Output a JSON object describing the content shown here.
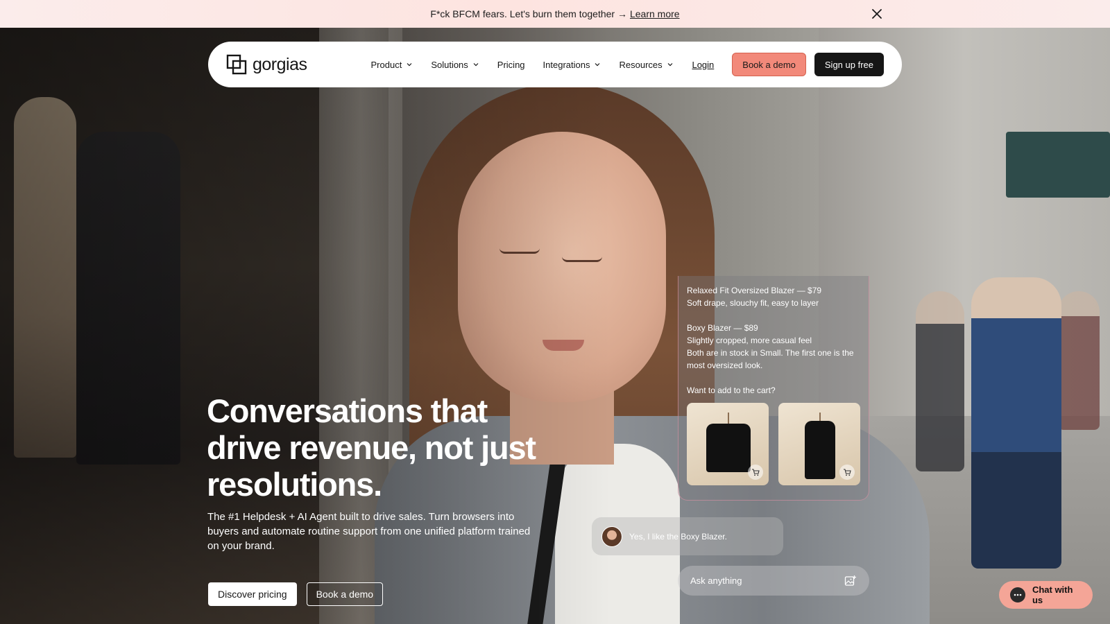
{
  "announcement": {
    "text": "F*ck BFCM fears. Let's burn them together →",
    "link_label": "Learn more"
  },
  "nav": {
    "logo": "gorgias",
    "items": [
      {
        "label": "Product",
        "has_dropdown": true
      },
      {
        "label": "Solutions",
        "has_dropdown": true
      },
      {
        "label": "Pricing",
        "has_dropdown": false
      },
      {
        "label": "Integrations",
        "has_dropdown": true
      },
      {
        "label": "Resources",
        "has_dropdown": true
      }
    ],
    "login": "Login",
    "book_demo": "Book a demo",
    "sign_up": "Sign up free"
  },
  "hero": {
    "title": "Conversations that drive revenue, not just resolutions.",
    "subtitle": "The #1 Helpdesk + AI Agent built to drive sales. Turn browsers into buyers and automate routine support from one unified platform trained on your brand.",
    "primary_button": "Discover pricing",
    "secondary_button": "Book a demo"
  },
  "chat": {
    "product1_title": "Relaxed Fit Oversized Blazer — $79",
    "product1_desc": "Soft drape, slouchy fit, easy to layer",
    "product2_title": "Boxy Blazer — $89",
    "product2_desc": "Slightly cropped, more casual feel",
    "stock_note": "Both are in stock in Small. The first one is the most oversized look.",
    "question": "Want to add to the cart?",
    "user_reply": "Yes, I like the Boxy Blazer.",
    "input_placeholder": "Ask anything"
  },
  "chat_widget": {
    "label": "Chat with us"
  },
  "colors": {
    "accent_coral": "#f2897a",
    "dark": "#161616",
    "banner_pink": "#fde4e0"
  }
}
